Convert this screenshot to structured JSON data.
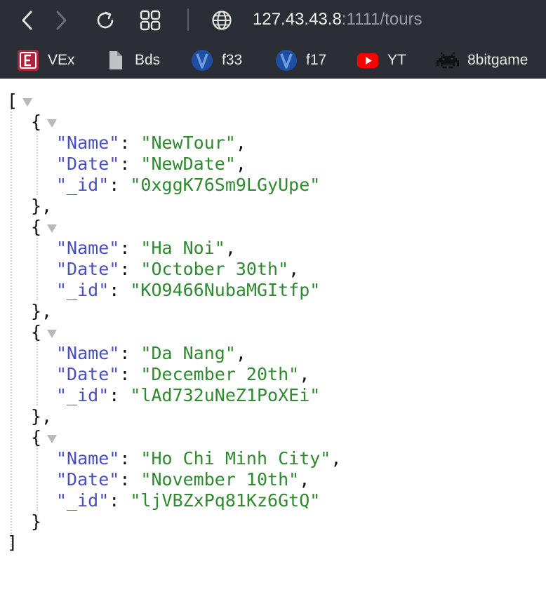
{
  "toolbar": {
    "url_host": "127.43.43.8",
    "url_rest": ":1111/tours",
    "icons": [
      "back-icon",
      "forward-icon",
      "reload-icon",
      "tab-overview-icon",
      "globe-icon"
    ]
  },
  "bookmarks": [
    {
      "label": "VEx",
      "icon": "vex-icon"
    },
    {
      "label": "Bds",
      "icon": "document-icon"
    },
    {
      "label": "f33",
      "icon": "blue-circle-icon"
    },
    {
      "label": "f17",
      "icon": "blue-circle-icon"
    },
    {
      "label": "YT",
      "icon": "youtube-icon"
    },
    {
      "label": "8bitgame",
      "icon": "space-invader-icon"
    }
  ],
  "json": {
    "open_bracket": "[",
    "close_bracket": "]",
    "open_brace": "{",
    "close_brace_comma": "},",
    "close_brace": "}",
    "tours": [
      {
        "Name": "\"NewTour\"",
        "Date": "\"NewDate\"",
        "_id": "\"0xggK76Sm9LGyUpe\""
      },
      {
        "Name": "\"Ha Noi\"",
        "Date": "\"October 30th\"",
        "_id": "\"KO9466NubaMGItfp\""
      },
      {
        "Name": "\"Da Nang\"",
        "Date": "\"December 20th\"",
        "_id": "\"lAd732uNeZ1PoXEi\""
      },
      {
        "Name": "\"Ho Chi Minh City\"",
        "Date": "\"November 10th\"",
        "_id": "\"ljVBZxPq81Kz6GtQ\""
      }
    ],
    "key_labels": {
      "name": "\"Name\"",
      "date": "\"Date\"",
      "id": "\"_id\""
    }
  },
  "colors": {
    "toolbar_bg": "#2b2e34",
    "key": "#4a4fbe",
    "string": "#2e8a2e",
    "triangle": "#b9b9b9"
  }
}
